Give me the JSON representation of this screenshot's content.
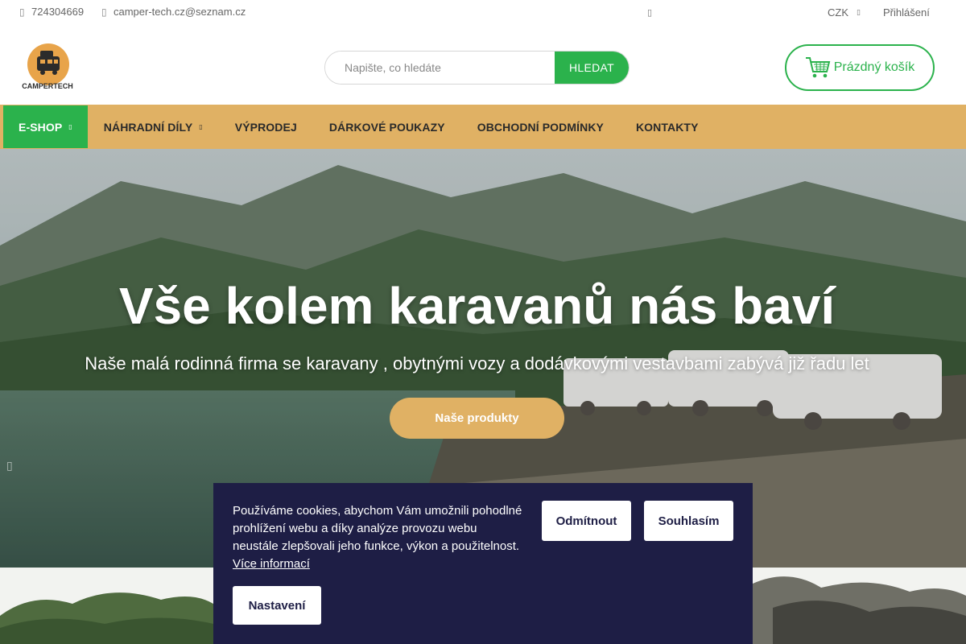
{
  "topbar": {
    "phone": "724304669",
    "email": "camper-tech.cz@seznam.cz",
    "currency": "CZK",
    "login": "Přihlášení",
    "icons": {
      "phone": "phone-icon",
      "email": "mail-icon",
      "facebook": "facebook-icon",
      "currency_caret": "chevron-down-icon"
    }
  },
  "header": {
    "logo_text": "CAMPERTECH",
    "search": {
      "placeholder": "Napište, co hledáte",
      "value": "",
      "button": "HLEDAT"
    },
    "cart": {
      "label": "Prázdný košík",
      "icon": "shopping-cart-icon"
    }
  },
  "nav": {
    "items": [
      {
        "label": "E-SHOP",
        "active": true,
        "dropdown": true
      },
      {
        "label": "NÁHRADNÍ DÍLY",
        "active": false,
        "dropdown": true
      },
      {
        "label": "VÝPRODEJ",
        "active": false,
        "dropdown": false
      },
      {
        "label": "DÁRKOVÉ POUKAZY",
        "active": false,
        "dropdown": false
      },
      {
        "label": "OBCHODNÍ PODMÍNKY",
        "active": false,
        "dropdown": false
      },
      {
        "label": "KONTAKTY",
        "active": false,
        "dropdown": false
      }
    ]
  },
  "hero": {
    "title": "Vše kolem karavanů nás baví",
    "subtitle": "Naše malá rodinná firma se karavany , obytnými vozy a dodávkovými vestavbami zabývá již řadu let",
    "cta": "Naše produkty"
  },
  "cookie": {
    "text": "Používáme cookies, abychom Vám umožnili pohodlné prohlížení webu a díky analýze provozu webu neustále zlepšovali jeho funkce, výkon a použitelnost.",
    "more": "Více informací",
    "decline": "Odmítnout",
    "accept": "Souhlasím",
    "settings": "Nastavení"
  },
  "colors": {
    "accent_green": "#2bb24c",
    "nav_gold": "#e0b164",
    "cookie_bg": "#1e1e45"
  }
}
